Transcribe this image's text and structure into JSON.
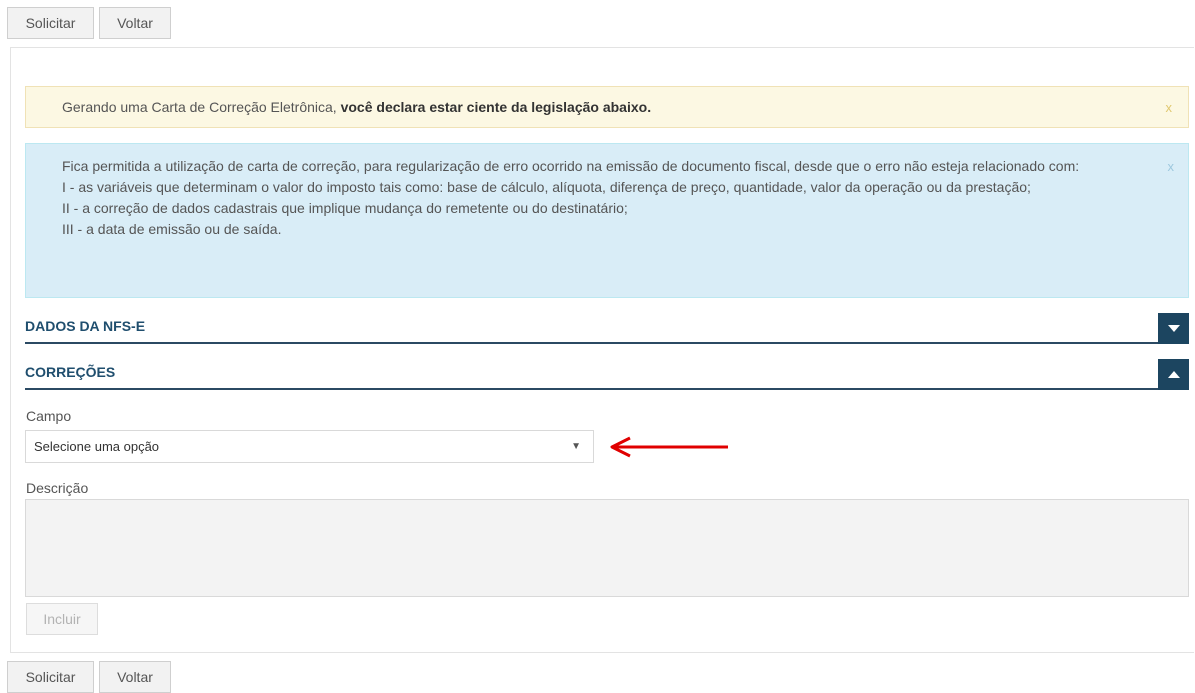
{
  "top_toolbar": {
    "solicitar_label": "Solicitar",
    "voltar_label": "Voltar"
  },
  "bottom_toolbar": {
    "solicitar_label": "Solicitar",
    "voltar_label": "Voltar"
  },
  "warning_alert": {
    "text_prefix": "Gerando uma Carta de Correção Eletrônica, ",
    "text_bold": "você declara estar ciente da legislação abaixo.",
    "close_label": "x"
  },
  "info_alert": {
    "lines": [
      "Fica permitida a utilização de carta de correção, para regularização de erro ocorrido na emissão de documento fiscal, desde que o erro não esteja relacionado com:",
      "I - as variáveis que determinam o valor do imposto tais como: base de cálculo, alíquota, diferença de preço, quantidade, valor da operação ou da prestação;",
      "II - a correção de dados cadastrais que implique mudança do remetente ou do destinatário;",
      "III - a data de emissão ou de saída."
    ],
    "close_label": "x"
  },
  "sections": {
    "dados": {
      "title": "DADOS DA NFS-E",
      "state": "collapsed"
    },
    "correcoes": {
      "title": "CORREÇÕES",
      "state": "expanded"
    }
  },
  "form": {
    "campo_label": "Campo",
    "campo_select_value": "Selecione uma opção",
    "descricao_label": "Descrição",
    "descricao_value": "",
    "incluir_label": "Incluir"
  },
  "colors": {
    "section_header": "#1c4560",
    "warning_bg": "#fcf8e3",
    "info_bg": "#d9edf7",
    "annotation_arrow": "#e00000"
  },
  "icons": {
    "dados_toggle": "chevron-down-icon",
    "correcoes_toggle": "chevron-up-icon",
    "select_caret": "caret-down-icon",
    "annotation": "red-arrow-left-icon"
  }
}
